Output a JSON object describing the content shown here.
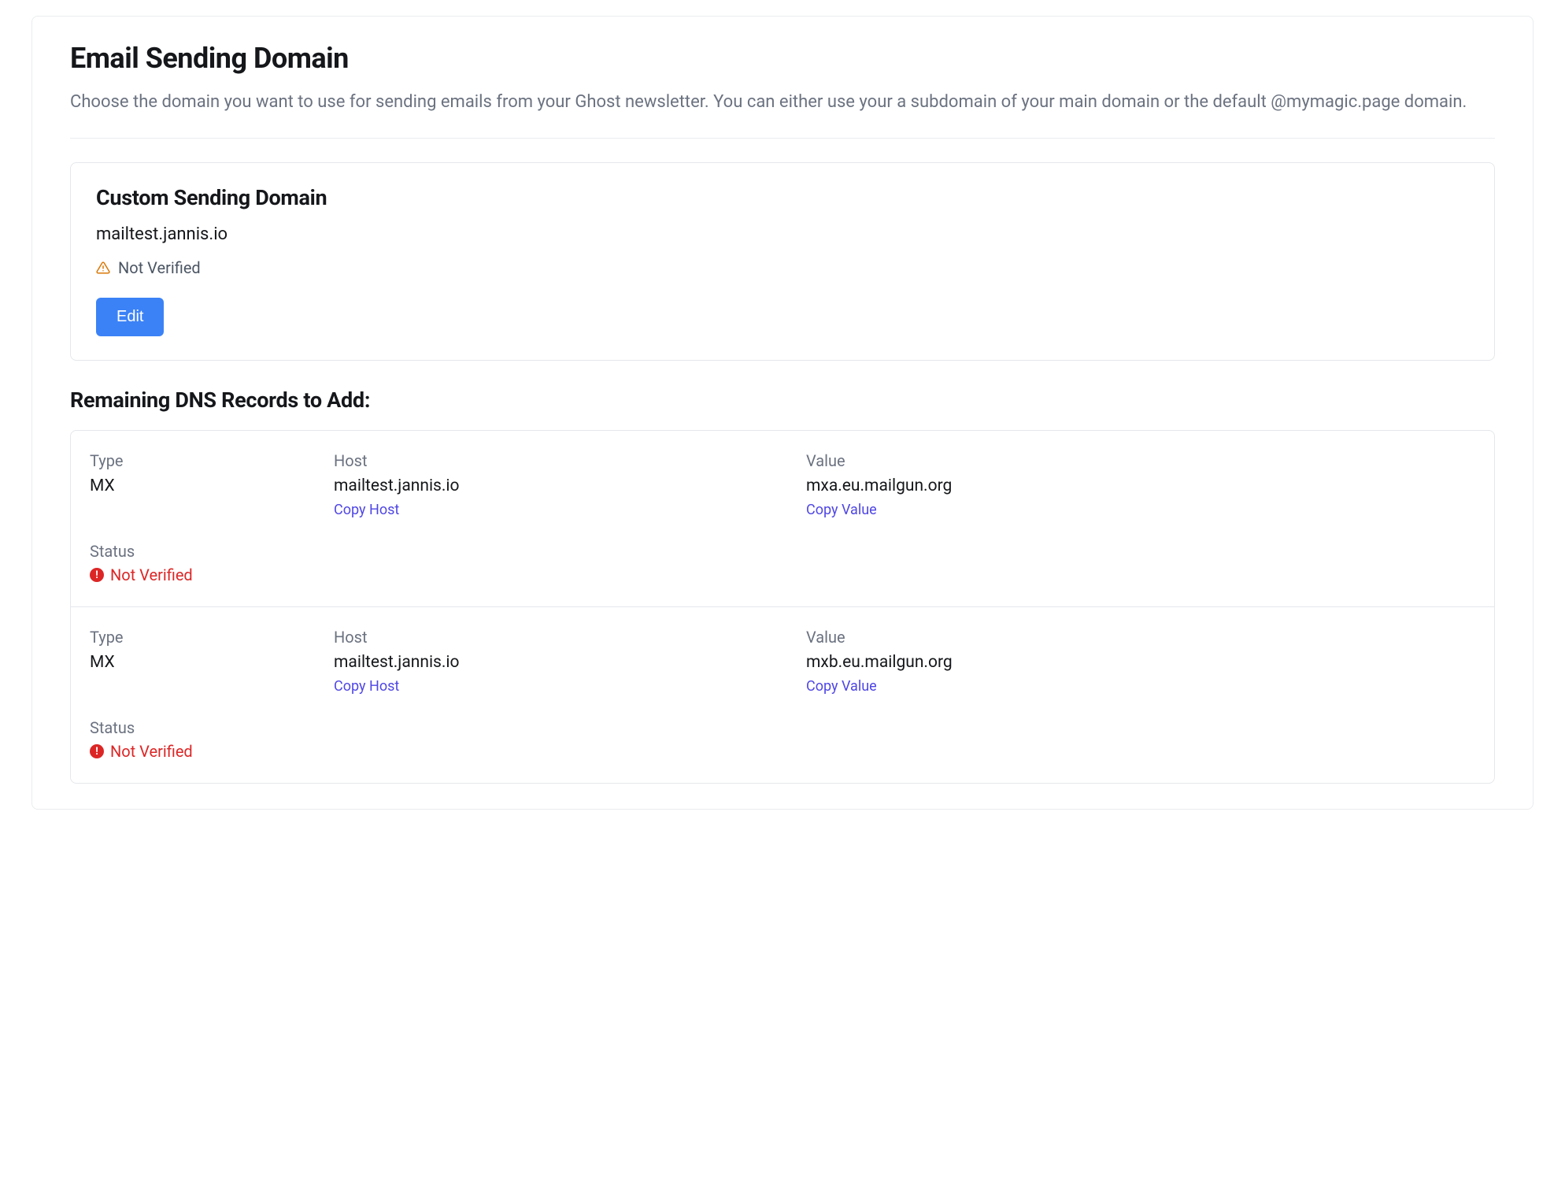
{
  "header": {
    "title": "Email Sending Domain",
    "description": "Choose the domain you want to use for sending emails from your Ghost newsletter. You can either use your a subdomain of your main domain or the default @mymagic.page domain."
  },
  "custom_domain": {
    "title": "Custom Sending Domain",
    "domain": "mailtest.jannis.io",
    "status_text": "Not Verified",
    "edit_label": "Edit"
  },
  "dns_section": {
    "title": "Remaining DNS Records to Add:",
    "labels": {
      "type": "Type",
      "host": "Host",
      "value": "Value",
      "status": "Status",
      "copy_host": "Copy Host",
      "copy_value": "Copy Value"
    },
    "records": [
      {
        "type": "MX",
        "host": "mailtest.jannis.io",
        "value": "mxa.eu.mailgun.org",
        "status": "Not Verified"
      },
      {
        "type": "MX",
        "host": "mailtest.jannis.io",
        "value": "mxb.eu.mailgun.org",
        "status": "Not Verified"
      }
    ]
  }
}
